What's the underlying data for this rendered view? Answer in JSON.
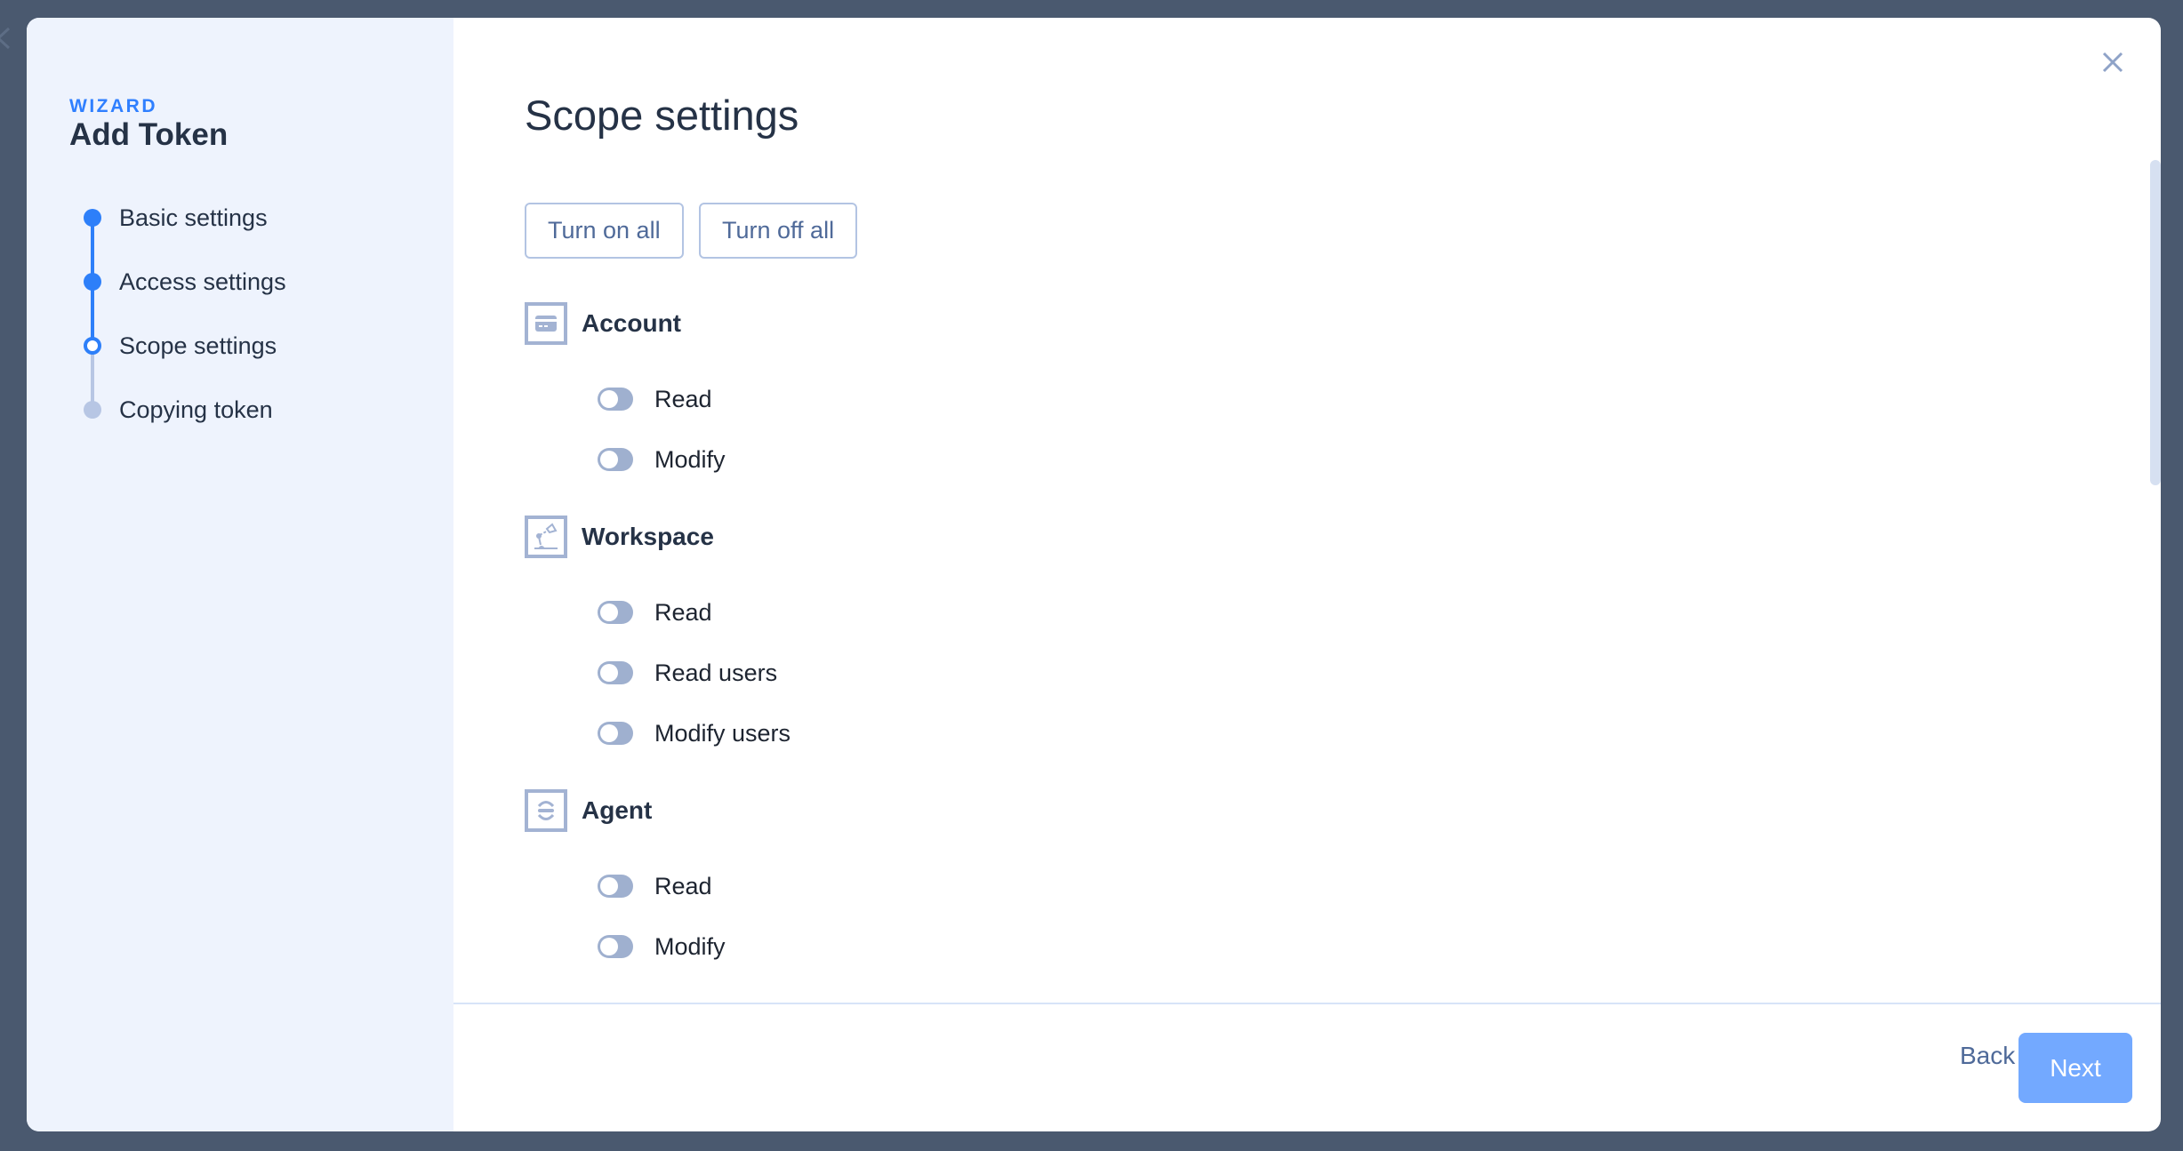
{
  "background": {
    "back_icon": "chevron-left-icon"
  },
  "wizard": {
    "eyebrow": "WIZARD",
    "title": "Add Token",
    "steps": [
      {
        "label": "Basic settings",
        "state": "done"
      },
      {
        "label": "Access settings",
        "state": "done"
      },
      {
        "label": "Scope settings",
        "state": "current"
      },
      {
        "label": "Copying token",
        "state": "pending"
      }
    ]
  },
  "main": {
    "title": "Scope settings",
    "turn_on_all_label": "Turn on all",
    "turn_off_all_label": "Turn off all",
    "sections": [
      {
        "title": "Account",
        "icon": "credit-card-icon",
        "toggles": [
          {
            "label": "Read",
            "on": false
          },
          {
            "label": "Modify",
            "on": false
          }
        ]
      },
      {
        "title": "Workspace",
        "icon": "desk-lamp-icon",
        "toggles": [
          {
            "label": "Read",
            "on": false
          },
          {
            "label": "Read users",
            "on": false
          },
          {
            "label": "Modify users",
            "on": false
          }
        ]
      },
      {
        "title": "Agent",
        "icon": "agent-face-icon",
        "toggles": [
          {
            "label": "Read",
            "on": false
          },
          {
            "label": "Modify",
            "on": false
          }
        ]
      }
    ]
  },
  "footer": {
    "back_label": "Back",
    "next_label": "Next"
  },
  "colors": {
    "accent": "#2d7ff9",
    "next_button": "#73a9ff",
    "toggle_off": "#9fb0cf",
    "sidebar_bg": "#eef3fd",
    "overlay": "#4a596f"
  }
}
